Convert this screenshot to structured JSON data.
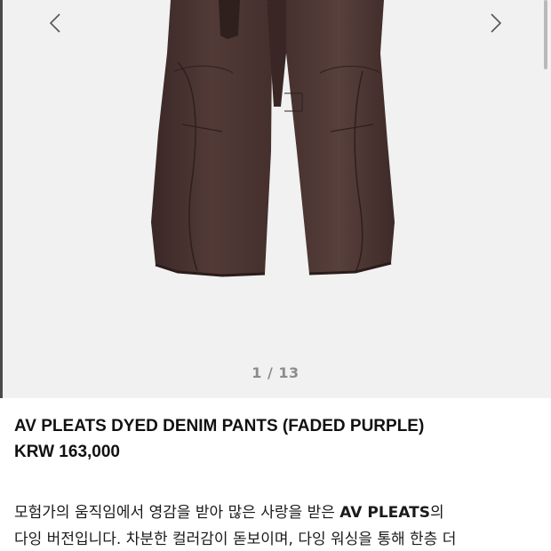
{
  "gallery": {
    "counter": "1 / 13",
    "prev_icon": "chevron-left-icon",
    "next_icon": "chevron-right-icon",
    "image_description_color": "#4b3533"
  },
  "product": {
    "title": "AV PLEATS DYED DENIM PANTS (FADED PURPLE)",
    "price": "KRW 163,000"
  },
  "description": {
    "line1_pre": "모험가의 움직임에서 영감을 받아 많은 사랑을 받은 ",
    "line1_bold": "AV PLEATS",
    "line1_post": "의",
    "line2": "다잉 버전입니다. 차분한 컬러감이 돋보이며, 다잉 워싱을 통해 한층 더"
  },
  "colors": {
    "gallery_bg": "#f1f1f1",
    "text": "#111111",
    "counter": "#8c8c8c"
  }
}
